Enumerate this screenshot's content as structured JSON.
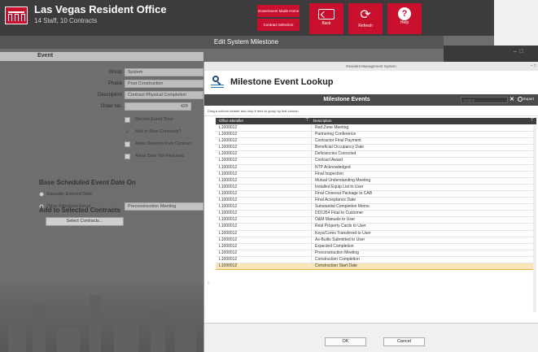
{
  "header": {
    "title": "Las Vegas Resident Office",
    "subtitle": "14 Staff, 10 Contracts",
    "government_mode": "Government Mode Home",
    "contract_selection": "Contract Selection",
    "back": "Back",
    "refresh": "Refresh",
    "help": "Help",
    "accent_color": "#c8102e"
  },
  "edit": {
    "title": "Edit System Milestone",
    "section_event": "Event",
    "group_label": "Group",
    "group_value": "System",
    "phase_label": "Phase",
    "phase_value": "Post Construction",
    "description_label": "Description",
    "description_value": "Contract Physical Completion",
    "order_label": "Order No.",
    "order_value": "428",
    "checkboxes": [
      {
        "label": "Record Event Time",
        "checked": false
      },
      {
        "label": "Add to New Contracts?",
        "checked": true
      },
      {
        "label": "Allow Deletion from Contract",
        "checked": false
      },
      {
        "label": "Allow Date Not Required",
        "checked": false
      }
    ],
    "base_title": "Base Scheduled Event Date On",
    "radio_manual": "Manually Entered Date",
    "radio_other": "Other Milestone Event",
    "other_value": "Preconstruction Meeting",
    "add_title": "Add to Selected Contracts",
    "select_contracts": "Select Contracts..."
  },
  "modal": {
    "window_title": "Resident Management System",
    "title": "Milestone Event Lookup",
    "grid_title": "Milestone Events",
    "search_placeholder": "Search",
    "export": "Export",
    "group_hint": "Drag a column header and drop it here to group by that column",
    "col_office": "Office Identifier",
    "col_description": "Description",
    "selected_index": 21,
    "rows": [
      {
        "id": "L1000012",
        "description": "Red Zone Meeting"
      },
      {
        "id": "L1000012",
        "description": "Partnering Conference"
      },
      {
        "id": "L1000012",
        "description": "Contractor Final Payment"
      },
      {
        "id": "L1000012",
        "description": "Beneficial Occupancy Date"
      },
      {
        "id": "L1000012",
        "description": "Deficiencies Corrected"
      },
      {
        "id": "L1000012",
        "description": "Contract Award"
      },
      {
        "id": "L1000012",
        "description": "NTP Acknowledged"
      },
      {
        "id": "L1000012",
        "description": "Final Inspection"
      },
      {
        "id": "L1000012",
        "description": "Mutual Understanding Meeting"
      },
      {
        "id": "L1000012",
        "description": "Installed Equip List to User"
      },
      {
        "id": "L1000012",
        "description": "Final Closeout Package to CAB"
      },
      {
        "id": "L1000012",
        "description": "Final Acceptance Date"
      },
      {
        "id": "L1000012",
        "description": "Substantial Completion Memo"
      },
      {
        "id": "L1000012",
        "description": "DD1354 Final to Customer"
      },
      {
        "id": "L1000012",
        "description": "O&M Manuals to User"
      },
      {
        "id": "L1000012",
        "description": "Real Property Cards to User"
      },
      {
        "id": "L1000012",
        "description": "Keys/Cores Transfered to User"
      },
      {
        "id": "L1000012",
        "description": "As-Builts Submitted to User"
      },
      {
        "id": "L1000012",
        "description": "Expected Completion"
      },
      {
        "id": "L1000012",
        "description": "Preconstruction Meeting"
      },
      {
        "id": "L1000012",
        "description": "Construction Completion"
      },
      {
        "id": "L1000012",
        "description": "Construction Start Date"
      }
    ],
    "ok": "OK",
    "cancel": "Cancel"
  }
}
